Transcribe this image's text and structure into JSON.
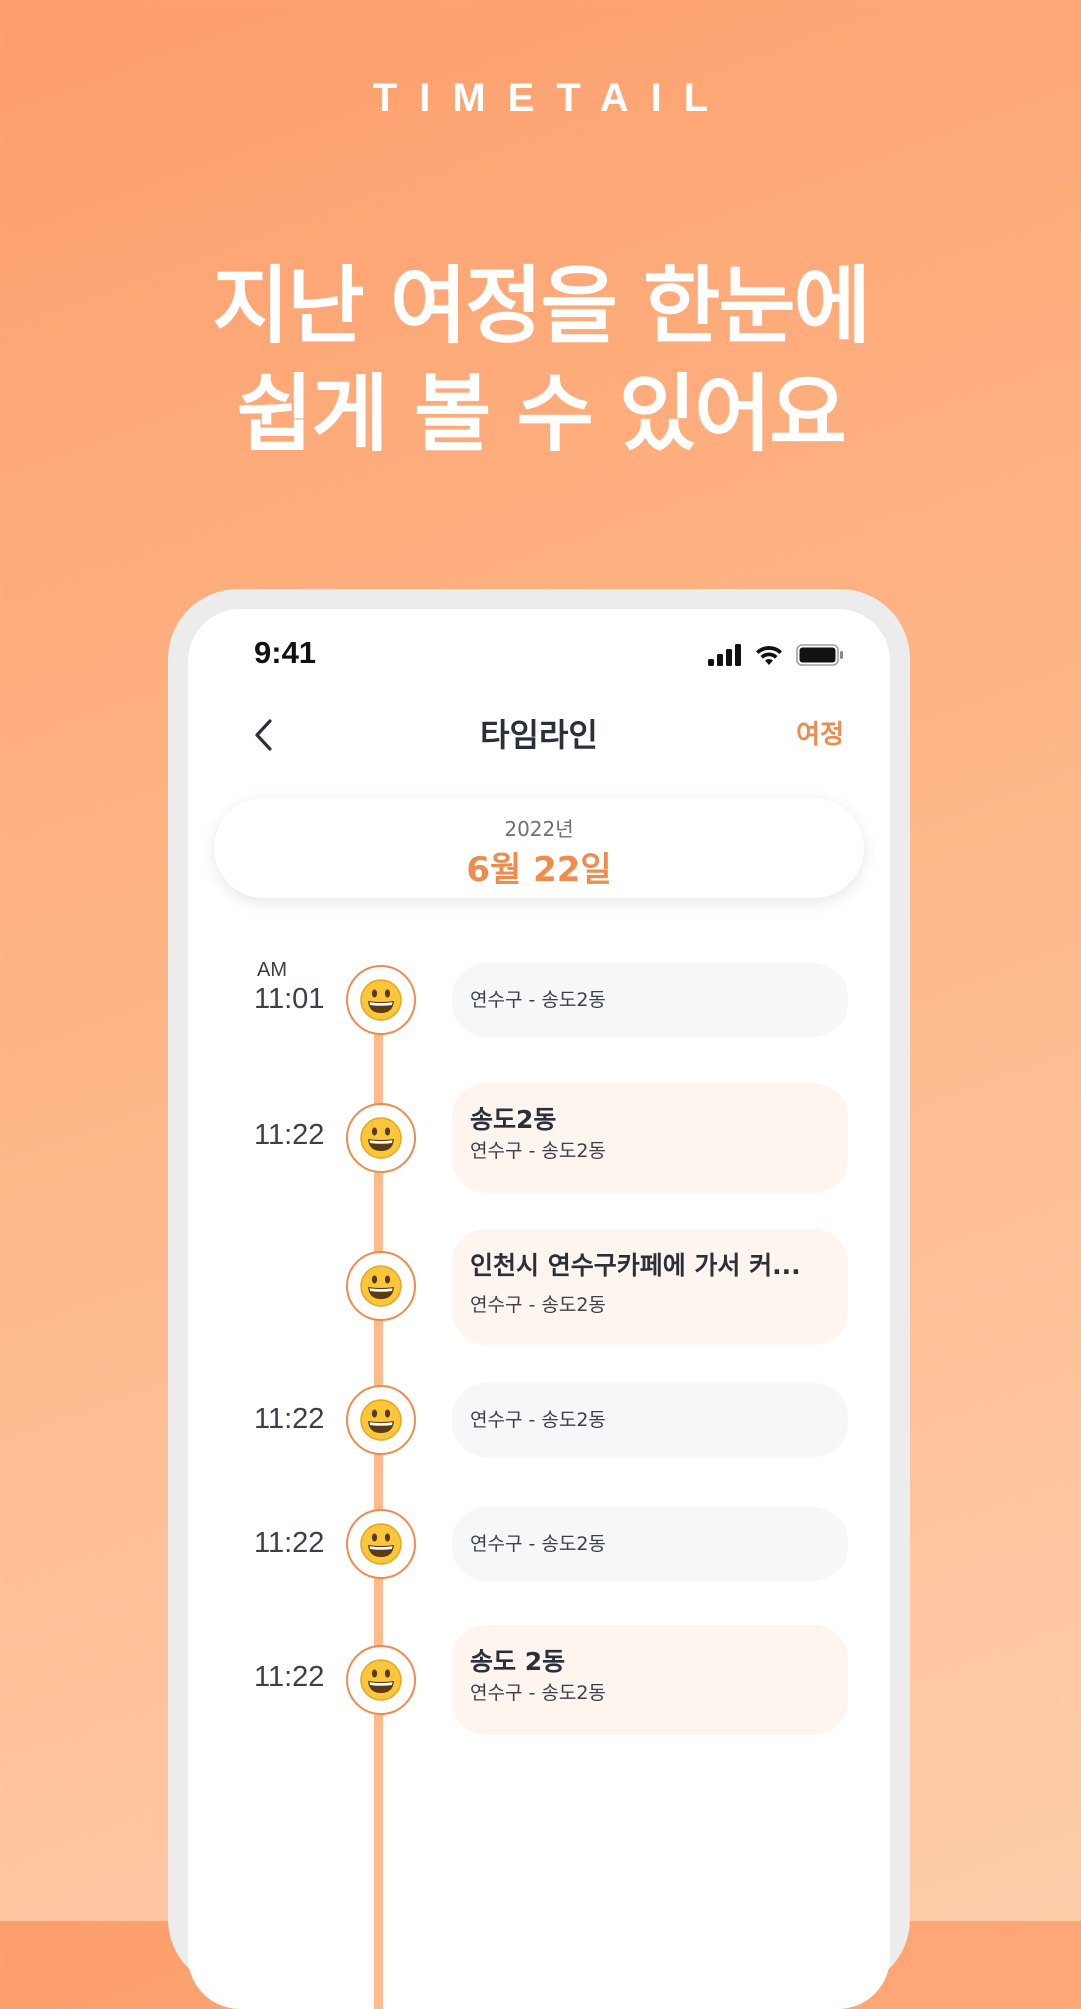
{
  "brand": "TIMETAIL",
  "headline": {
    "line1": "지난 여정을 한눈에",
    "line2": "쉽게 볼 수 있어요"
  },
  "status_bar": {
    "time": "9:41",
    "icons": [
      "cellular-signal-icon",
      "wifi-icon",
      "battery-icon"
    ]
  },
  "nav": {
    "title": "타임라인",
    "right_action": "여정",
    "back_icon": "chevron-left-icon"
  },
  "date": {
    "year": "2022년",
    "day": "6월 22일"
  },
  "timeline": {
    "entries": [
      {
        "ampm": "AM",
        "time": "11:01",
        "avatar": "grinning-face-emoji",
        "title": "",
        "location": "연수구 - 송도2동"
      },
      {
        "ampm": "",
        "time": "11:22",
        "avatar": "grinning-face-emoji",
        "title": "송도2동",
        "location": "연수구 - 송도2동"
      },
      {
        "ampm": "",
        "time": "",
        "avatar": "grinning-face-emoji",
        "title": "인천시 연수구카페에 가서 커...",
        "location": "연수구 - 송도2동"
      },
      {
        "ampm": "",
        "time": "11:22",
        "avatar": "grinning-face-emoji",
        "title": "",
        "location": "연수구 - 송도2동"
      },
      {
        "ampm": "",
        "time": "11:22",
        "avatar": "grinning-face-emoji",
        "title": "",
        "location": "연수구 - 송도2동"
      },
      {
        "ampm": "",
        "time": "11:22",
        "avatar": "grinning-face-emoji",
        "title": "송도 2동",
        "location": "연수구 - 송도2동"
      }
    ]
  },
  "colors": {
    "accent": "#f08b4e",
    "timeline_line": "#fdbb8c",
    "card_plain": "#f6f7f9",
    "card_rich": "#fef5ee",
    "background_start": "#fd9e6c",
    "background_end": "#fecdab"
  }
}
